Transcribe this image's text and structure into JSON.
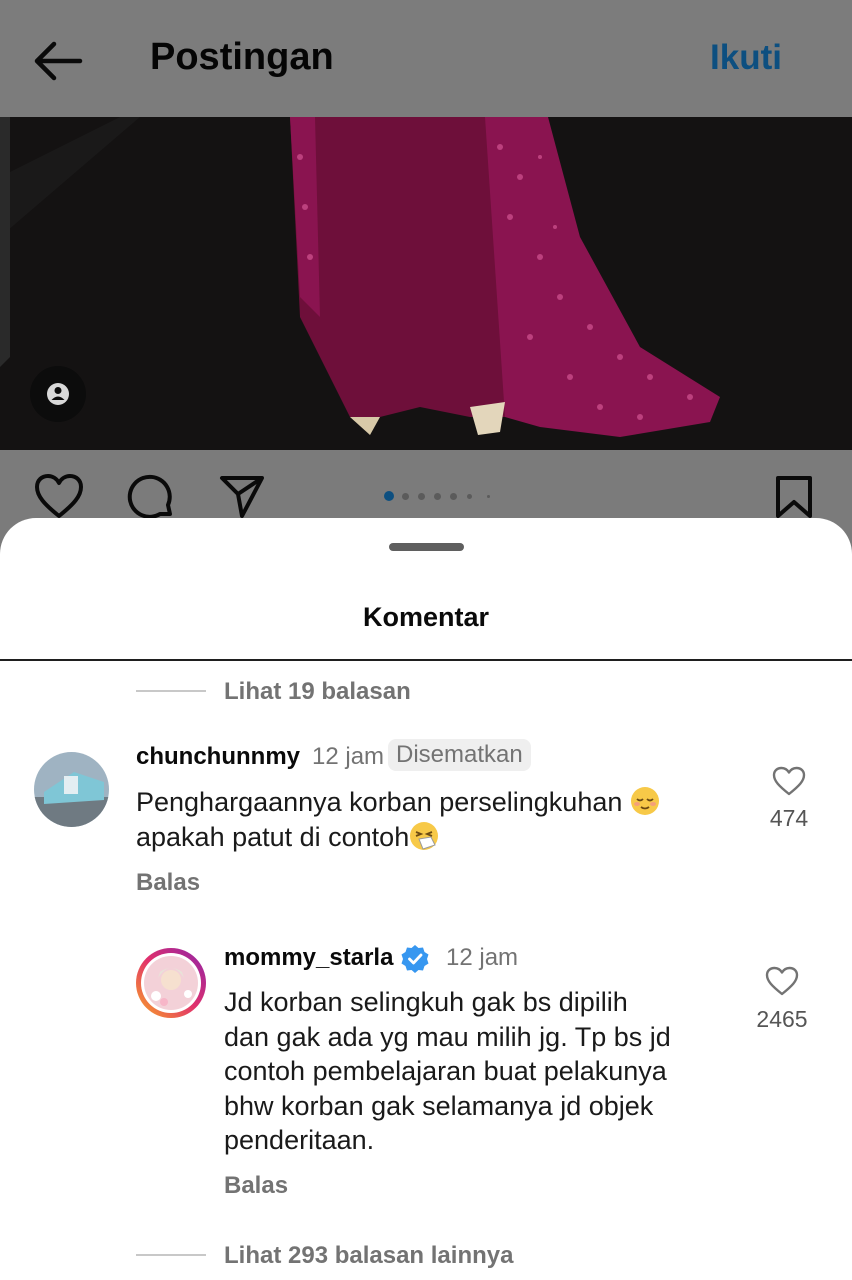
{
  "header": {
    "title": "Postingan",
    "follow_label": "Ikuti",
    "back_icon": "arrow-left-icon"
  },
  "post": {
    "carousel_pages": 7,
    "carousel_current": 1,
    "tag_icon": "person-tag-icon",
    "actions": [
      "heart-icon",
      "comment-icon",
      "share-icon",
      "bookmark-icon"
    ]
  },
  "sheet": {
    "title": "Komentar",
    "top_view_replies": "Lihat 19 balasan",
    "bottom_view_replies": "Lihat 293 balasan lainnya"
  },
  "comments": [
    {
      "username": "chunchunnmy",
      "time": "12 jam",
      "pinned_label": "Disematkan",
      "text_line1": "Penghargaannya korban perselingkuhan",
      "text_line2": "apakah patut di contoh",
      "emoji1": "relieved-face-emoji",
      "emoji2": "sneezing-face-emoji",
      "reply_label": "Balas",
      "likes": "474"
    },
    {
      "username": "mommy_starla",
      "verified": true,
      "time": "12 jam",
      "text_lines": [
        "Jd korban selingkuh gak bs dipilih",
        "dan gak ada yg mau milih jg. Tp bs jd",
        "contoh pembelajaran buat pelakunya",
        "bhw korban gak selamanya jd objek",
        "penderitaan."
      ],
      "reply_label": "Balas",
      "likes": "2465"
    }
  ],
  "colors": {
    "overlay_gray": "#7c7c7c",
    "follow_blue": "#0d4f80",
    "verified_blue": "#3797f0",
    "muted_text": "#737373",
    "dress_magenta": "#7a1040"
  }
}
